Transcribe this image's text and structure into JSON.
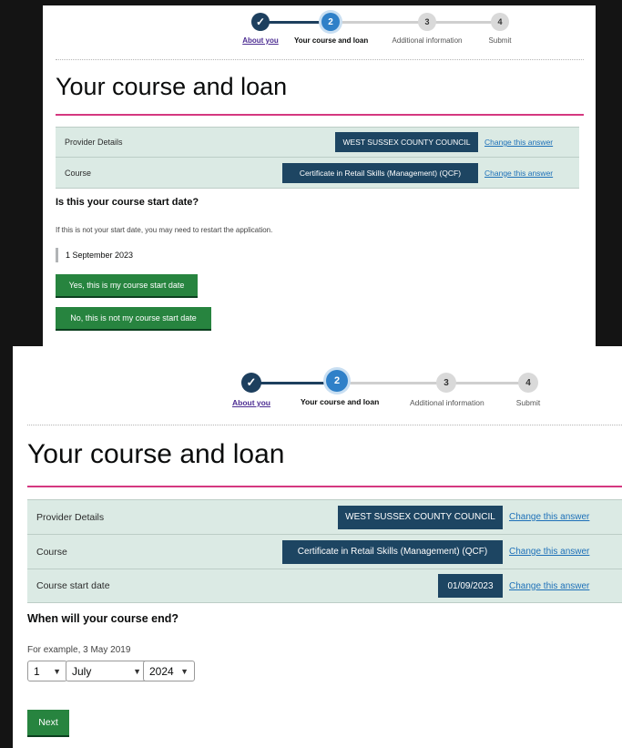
{
  "stepper": {
    "steps": [
      {
        "number": "✓",
        "label": "About you"
      },
      {
        "number": "2",
        "label": "Your course and loan"
      },
      {
        "number": "3",
        "label": "Additional information"
      },
      {
        "number": "4",
        "label": "Submit"
      }
    ]
  },
  "screen1": {
    "title": "Your course and loan",
    "summary": [
      {
        "key": "Provider Details",
        "value": "WEST SUSSEX COUNTY COUNCIL",
        "change": "Change this answer"
      },
      {
        "key": "Course",
        "value": "Certificate in Retail Skills (Management) (QCF)",
        "change": "Change this answer"
      }
    ],
    "question": "Is this your course start date?",
    "hint": "If this is not your start date, you may need to restart the application.",
    "start_date": "1 September 2023",
    "yes_button": "Yes, this is my course start date",
    "no_button": "No, this is not my course start date"
  },
  "screen2": {
    "title": "Your course and loan",
    "summary": [
      {
        "key": "Provider Details",
        "value": "WEST SUSSEX COUNTY COUNCIL",
        "change": "Change this answer"
      },
      {
        "key": "Course",
        "value": "Certificate in Retail Skills (Management) (QCF)",
        "change": "Change this answer"
      },
      {
        "key": "Course start date",
        "value": "01/09/2023",
        "change": "Change this answer"
      }
    ],
    "question": "When will your course end?",
    "hint": "For example, 3 May 2019",
    "day": "1",
    "month": "July",
    "year": "2024",
    "next_button": "Next"
  },
  "colors": {
    "background": "#141414",
    "tag": "#1d4562",
    "summary_bg": "#dbeae4",
    "button": "#27843f",
    "accent_rule": "#d53880",
    "link": "#1d70b8"
  }
}
